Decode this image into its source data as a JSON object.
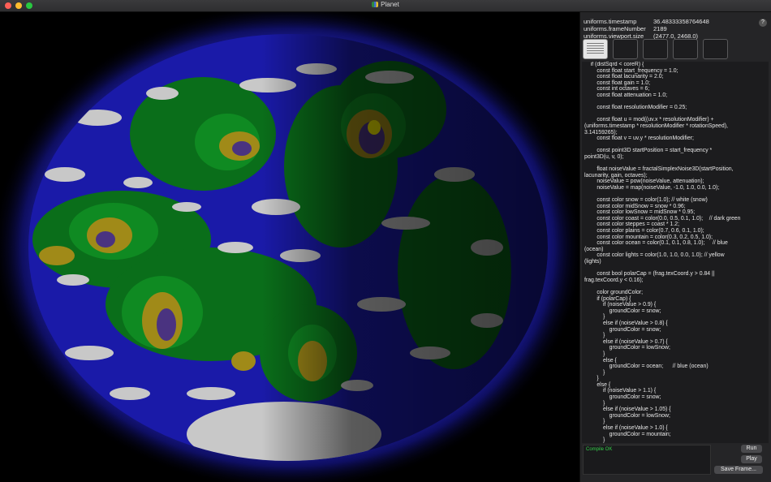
{
  "window": {
    "title": "Planet",
    "app_icon": "planet-app-icon"
  },
  "uniforms": [
    {
      "name": "uniforms.timestamp",
      "value": "36.48333358764648"
    },
    {
      "name": "uniforms.frameNumber",
      "value": "2189"
    },
    {
      "name": "uniforms.viewport.size",
      "value": "(2477.0, 2468.0)"
    }
  ],
  "help_label": "?",
  "shader_code": "    if (distSqrd < coreR) {\n        const float start_frequency = 1.0;\n        const float lacunarity = 2.0;\n        const float gain = 1.0;\n        const int octaves = 6;\n        const float attenuation = 1.0;\n\n        const float resolutionModifier = 0.25;\n\n        const float u = mod((uv.x * resolutionModifier) +\n(uniforms.timestamp * resolutionModifier * rotationSpeed),\n3.14159265);\n        const float v = uv.y * resolutionModifier;\n\n        const point3D startPosition = start_frequency *\npoint3D(u, v, 0);\n\n        float noiseValue = fractalSimplexNoise3D(startPosition,\nlacunarity, gain, octaves);\n        noiseValue = pow(noiseValue, attenuation);\n        noiseValue = map(noiseValue, -1.0, 1.0, 0.0, 1.0);\n\n        const color snow = color(1.0); // white (snow)\n        const color midSnow = snow * 0.96;\n        const color lowSnow = midSnow * 0.95;\n        const color coast = color(0.0, 0.5, 0.1, 1.0);    // dark green\n        const color steppes = coast * 1.2;\n        const color plains = color(0.7, 0.6, 0.1, 1.0);\n        const color mountain = color(0.3, 0.2, 0.5, 1.0);\n        const color ocean = color(0.1, 0.1, 0.8, 1.0);     // blue\n(ocean)\n        const color lights = color(1.0, 1.0, 0.0, 1.0); // yellow\n(lights)\n\n        const bool polarCap = (frag.texCoord.y > 0.84 ||\nfrag.texCoord.y < 0.16);\n\n        color groundColor;\n        if (polarCap) {\n            if (noiseValue > 0.9) {\n                groundColor = snow;\n            }\n            else if (noiseValue > 0.8) {\n                groundColor = snow;\n            }\n            else if (noiseValue > 0.7) {\n                groundColor = lowSnow;\n            }\n            else {\n                groundColor = ocean;      // blue (ocean)\n            }\n        }\n        else {\n            if (noiseValue > 1.1) {\n                groundColor = snow;\n            }\n            else if (noiseValue > 1.05) {\n                groundColor = lowSnow;\n            }\n            else if (noiseValue > 1.0) {\n                groundColor = mountain;\n            }\n            else if (noiseValue > 0.9) {\n                groundColor = plains;\n            }\n            else if (noiseValue > 0.8) {\n                groundColor = steppes;\n            }\n            else if (noiseValue > 0.7) {\n                groundColor = coast;\n            }",
  "console_text": "Compile OK",
  "buttons": {
    "run": "Run",
    "play": "Play",
    "save_frame": "Save Frame..."
  },
  "colors": {
    "ocean": "#1a1aa8",
    "coast": "#0a6e1a",
    "steppes": "#0f8a22",
    "plains": "#a08a18",
    "mountain": "#4a3380",
    "snow": "#c8c8c8",
    "lights": "#e8e000",
    "glow": "#2a2ad0"
  }
}
